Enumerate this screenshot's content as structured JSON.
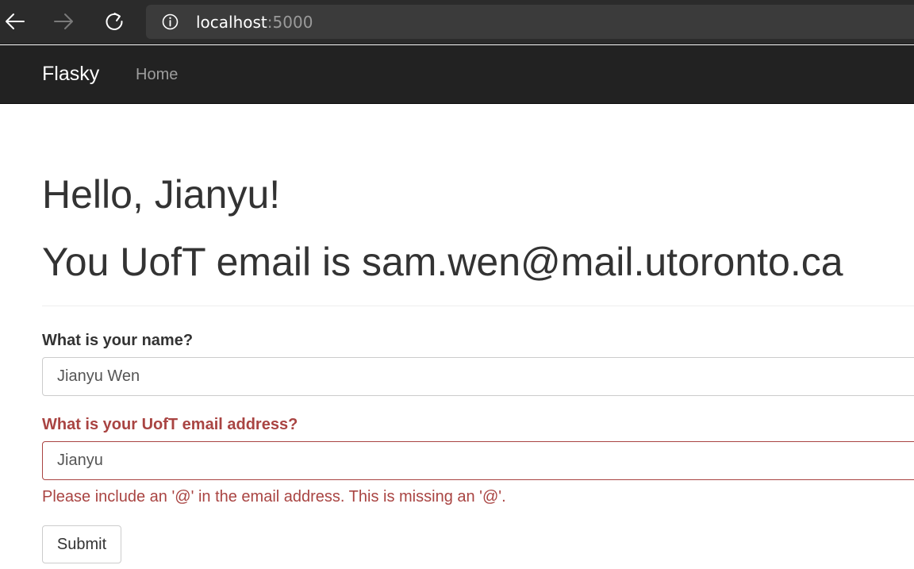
{
  "browser": {
    "url_host": "localhost",
    "url_port": ":5000",
    "icons": {
      "back": "arrow-left-icon",
      "forward": "arrow-right-icon",
      "reload": "reload-icon",
      "info": "info-icon"
    }
  },
  "navbar": {
    "brand": "Flasky",
    "items": [
      {
        "label": "Home"
      }
    ]
  },
  "main": {
    "greeting": "Hello, Jianyu!",
    "email_message": "You UofT email is sam.wen@mail.utoronto.ca"
  },
  "form": {
    "name_label": "What is your name?",
    "name_value": "Jianyu Wen",
    "email_label": "What is your UofT email address?",
    "email_value": "Jianyu",
    "email_error": "Please include an '@' in the email address. This is missing an '@'.",
    "submit_label": "Submit"
  },
  "colors": {
    "navbar_bg": "#222222",
    "error": "#a94442",
    "text": "#333333"
  }
}
